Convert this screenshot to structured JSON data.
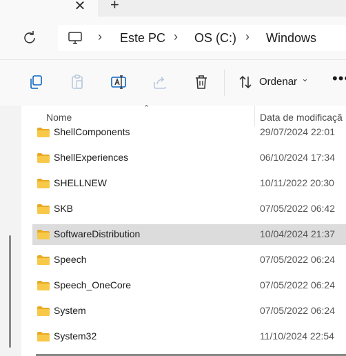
{
  "window": {
    "tab_close_glyph": "✕",
    "new_tab_glyph": "+"
  },
  "address_bar": {
    "breadcrumbs": [
      "Este PC",
      "OS (C:)",
      "Windows"
    ],
    "separator_glyph": "›"
  },
  "toolbar": {
    "sort_label": "Ordenar",
    "sort_chevron": "⌄",
    "more_glyph": "•••",
    "icons": [
      "copy-icon",
      "paste-icon",
      "rename-icon",
      "share-icon",
      "delete-icon",
      "sort-icon"
    ]
  },
  "file_list": {
    "columns": {
      "name": "Nome",
      "date": "Data de modificaçã"
    },
    "sort_glyph": "⌃",
    "rows": [
      {
        "name": "ShellComponents",
        "date": "29/07/2024 22:01",
        "selected": false
      },
      {
        "name": "ShellExperiences",
        "date": "06/10/2024 17:34",
        "selected": false
      },
      {
        "name": "SHELLNEW",
        "date": "10/11/2022 20:30",
        "selected": false
      },
      {
        "name": "SKB",
        "date": "07/05/2022 06:42",
        "selected": false
      },
      {
        "name": "SoftwareDistribution",
        "date": "10/04/2024 21:37",
        "selected": true
      },
      {
        "name": "Speech",
        "date": "07/05/2022 06:24",
        "selected": false
      },
      {
        "name": "Speech_OneCore",
        "date": "07/05/2022 06:24",
        "selected": false
      },
      {
        "name": "System",
        "date": "07/05/2022 06:24",
        "selected": false
      },
      {
        "name": "System32",
        "date": "11/10/2024 22:54",
        "selected": false
      }
    ]
  },
  "colors": {
    "folder": "#f8c948",
    "folder_tab": "#e8a925",
    "selection": "#dcdcdc",
    "accent": "#0a64c2"
  }
}
